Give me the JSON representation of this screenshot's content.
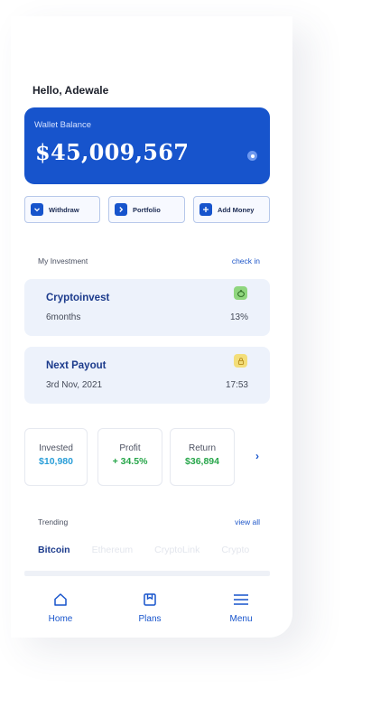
{
  "greeting": "Hello, Adewale",
  "wallet": {
    "label": "Wallet Balance",
    "amount": "$45,009,567",
    "accent": "#1754cc"
  },
  "actions": [
    {
      "label": "Withdraw",
      "icon": "chevron-down-icon"
    },
    {
      "label": "Portfolio",
      "icon": "chevron-right-icon"
    },
    {
      "label": "Add Money",
      "icon": "plus-icon"
    }
  ],
  "investment": {
    "heading": "My Investment",
    "link": "check in",
    "cards": [
      {
        "title": "Cryptoinvest",
        "subtitle": "6months",
        "right": "13%",
        "icon": "piggy-bank-icon",
        "icon_color": "#8fd67e"
      },
      {
        "title": "Next Payout",
        "subtitle": "3rd Nov, 2021",
        "right": "17:53",
        "icon": "lock-icon",
        "icon_color": "#f3de7a"
      }
    ]
  },
  "stats": [
    {
      "label": "Invested",
      "value": "$10,980",
      "color": "#2a9ed8"
    },
    {
      "label": "Profit",
      "value": "+ 34.5%",
      "color": "#27a64a"
    },
    {
      "label": "Return",
      "value": "$36,894",
      "color": "#27a64a"
    }
  ],
  "trending": {
    "heading": "Trending",
    "link": "view all",
    "tabs": [
      "Bitcoin",
      "Ethereum",
      "CryptoLink",
      "Crypto"
    ],
    "active_tab": "Bitcoin"
  },
  "bottom_nav": [
    {
      "label": "Home",
      "icon": "home-icon"
    },
    {
      "label": "Plans",
      "icon": "plans-icon"
    },
    {
      "label": "Menu",
      "icon": "menu-icon"
    }
  ],
  "page_indicator": {
    "count": 3,
    "active": 1
  }
}
